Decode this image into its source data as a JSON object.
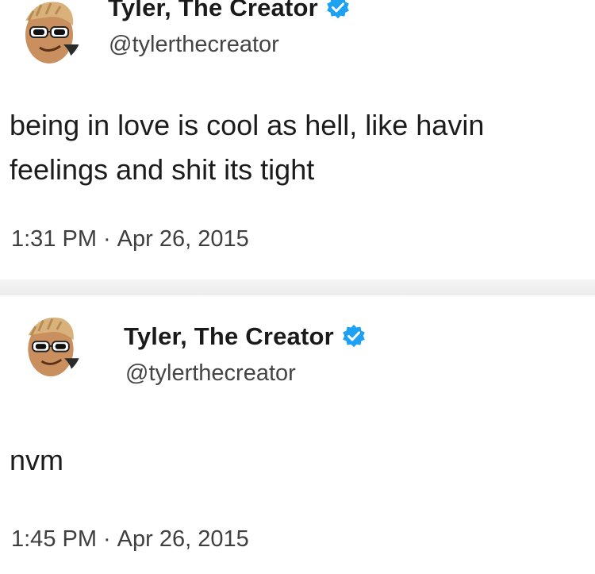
{
  "tweets": [
    {
      "author": {
        "display_name": "Tyler, The Creator",
        "handle": "@tylerthecreator",
        "verified_icon": "verified-badge-icon"
      },
      "text_lines": [
        "being in love is cool as hell, like havin",
        "feelings and shit its tight"
      ],
      "time": "1:31 PM",
      "separator": "·",
      "date": "Apr 26, 2015"
    },
    {
      "author": {
        "display_name": "Tyler, The Creator",
        "handle": "@tylerthecreator",
        "verified_icon": "verified-badge-icon"
      },
      "text_lines": [
        "nvm"
      ],
      "time": "1:45 PM",
      "separator": "·",
      "date": "Apr 26, 2015"
    }
  ],
  "colors": {
    "verified_blue": "#1da1f2",
    "text": "#14171a",
    "secondary": "#444444"
  }
}
